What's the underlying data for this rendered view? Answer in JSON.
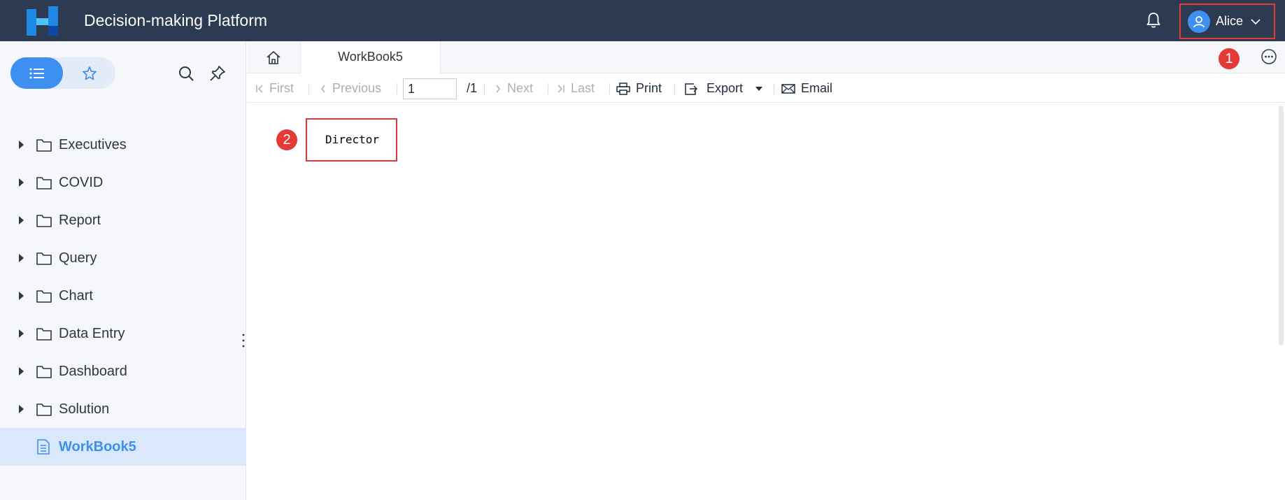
{
  "header": {
    "app_title": "Decision-making Platform",
    "user_name": "Alice"
  },
  "sidebar": {
    "items": [
      {
        "label": "Executives",
        "type": "folder"
      },
      {
        "label": "COVID",
        "type": "folder"
      },
      {
        "label": "Report",
        "type": "folder"
      },
      {
        "label": "Query",
        "type": "folder"
      },
      {
        "label": "Chart",
        "type": "folder"
      },
      {
        "label": "Data Entry",
        "type": "folder"
      },
      {
        "label": "Dashboard",
        "type": "folder"
      },
      {
        "label": "Solution",
        "type": "folder"
      },
      {
        "label": "WorkBook5",
        "type": "file",
        "active": true
      }
    ]
  },
  "tabs": {
    "active_tab": "WorkBook5"
  },
  "annotations": {
    "badge_1": "1",
    "badge_2": "2"
  },
  "toolbar": {
    "first": "First",
    "previous": "Previous",
    "page_value": "1",
    "page_total": "/1",
    "next": "Next",
    "last": "Last",
    "print": "Print",
    "export": "Export",
    "email": "Email"
  },
  "report": {
    "cell_text": "Director"
  },
  "colors": {
    "header_bg": "#2c3a52",
    "accent": "#3d8ff0",
    "highlight_red": "#e53935",
    "sidebar_bg": "#f5f7fa",
    "active_item_bg": "#dbe8fb"
  }
}
